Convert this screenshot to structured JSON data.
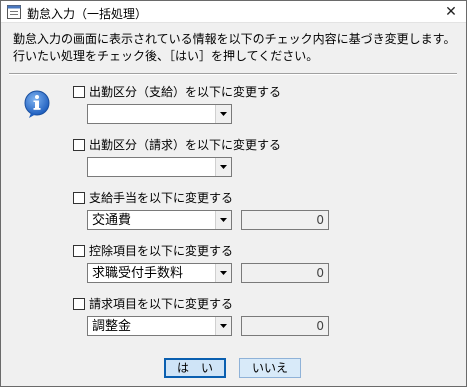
{
  "window": {
    "title": "勤怠入力（一括処理）",
    "close_symbol": "✕"
  },
  "description": {
    "line1": "勤怠入力の画面に表示されている情報を以下のチェック内容に基づき変更します。",
    "line2": "行いたい処理をチェック後、［はい］を押してください。"
  },
  "options": [
    {
      "label": "出勤区分（支給）を以下に変更する",
      "checked": false,
      "combo_value": "",
      "has_amount": false
    },
    {
      "label": "出勤区分（請求）を以下に変更する",
      "checked": false,
      "combo_value": "",
      "has_amount": false
    },
    {
      "label": "支給手当を以下に変更する",
      "checked": false,
      "combo_value": "交通費",
      "has_amount": true,
      "amount": "0"
    },
    {
      "label": "控除項目を以下に変更する",
      "checked": false,
      "combo_value": "求職受付手数料",
      "has_amount": true,
      "amount": "0"
    },
    {
      "label": "請求項目を以下に変更する",
      "checked": false,
      "combo_value": "調整金",
      "has_amount": true,
      "amount": "0"
    }
  ],
  "buttons": {
    "yes_label": "は　い",
    "no_label": "いいえ"
  },
  "icons": {
    "title": "form-window-icon",
    "info": "information-icon"
  },
  "colors": {
    "button_bg": "#d8eaf9",
    "default_border": "#0a5fb0",
    "info_blue": "#1f5fbf"
  }
}
